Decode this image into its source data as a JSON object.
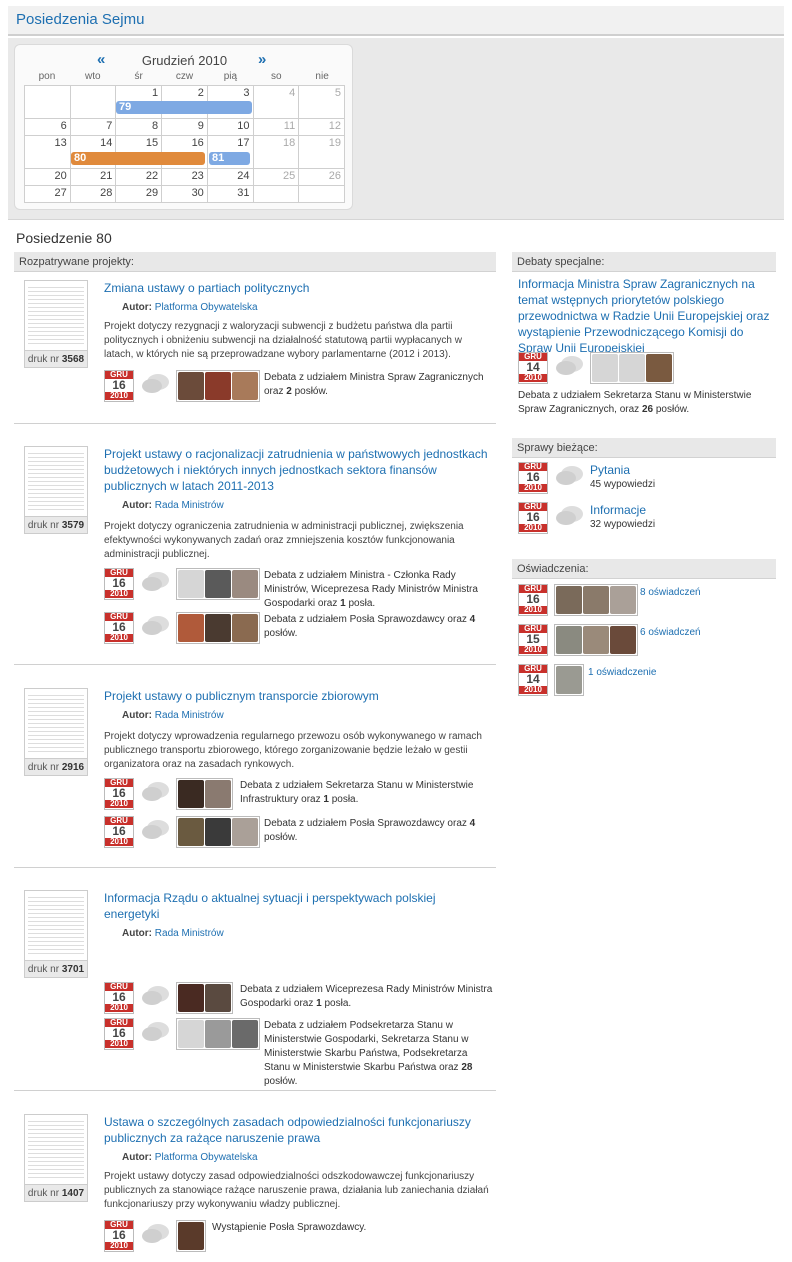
{
  "header": {
    "title": "Posiedzenia Sejmu"
  },
  "calendar": {
    "prev": "«",
    "next": "»",
    "month": "Grudzień 2010",
    "dow": [
      "pon",
      "wto",
      "śr",
      "czw",
      "pią",
      "so",
      "nie"
    ],
    "weeks": [
      [
        "",
        "",
        "1",
        "2",
        "3",
        "4",
        "5"
      ],
      [
        "6",
        "7",
        "8",
        "9",
        "10",
        "11",
        "12"
      ],
      [
        "13",
        "14",
        "15",
        "16",
        "17",
        "18",
        "19"
      ],
      [
        "20",
        "21",
        "22",
        "23",
        "24",
        "25",
        "26"
      ],
      [
        "27",
        "28",
        "29",
        "30",
        "31",
        "",
        ""
      ]
    ],
    "sittings": [
      {
        "label": "79",
        "color": "#7ea9e3"
      },
      {
        "label": "80",
        "color": "#e08a3c"
      },
      {
        "label": "81",
        "color": "#7ea9e3"
      }
    ]
  },
  "sitting": {
    "title": "Posiedzenie 80"
  },
  "projects_header": "Rozpatrywane projekty:",
  "author_label": "Autor:",
  "druk_label": "druk nr",
  "date": {
    "month": "GRU",
    "year": "2010"
  },
  "projects": [
    {
      "title": "Zmiana ustawy o partiach politycznych",
      "author": "Platforma Obywatelska",
      "druk": "3568",
      "desc": "Projekt dotyczy rezygnacji z waloryzacji subwencji z budżetu państwa dla partii politycznych i obniżeniu subwencji na działalność statutową partii wypłacanych w latach, w których nie są przeprowadzane wybory parlamentarne (2012 i 2013).",
      "debates": [
        {
          "day": "16",
          "text_a": "Debata z udziałem Ministra Spraw Zagranicznych oraz ",
          "count": "2",
          "text_b": " posłów."
        }
      ]
    },
    {
      "title": "Projekt ustawy o racjonalizacji zatrudnienia w państwowych jednostkach budżetowych i niektórych innych jednostkach sektora finansów publicznych w latach 2011-2013",
      "author": "Rada Ministrów",
      "druk": "3579",
      "desc": "Projekt dotyczy ograniczenia zatrudnienia w administracji publicznej, zwiększenia efektywności wykonywanych zadań oraz zmniejszenia kosztów funkcjonowania administracji publicznej.",
      "debates": [
        {
          "day": "16",
          "text_a": "Debata z udziałem Ministra - Członka Rady Ministrów, Wiceprezesa Rady Ministrów Ministra Gospodarki oraz ",
          "count": "1",
          "text_b": " posła."
        },
        {
          "day": "16",
          "text_a": "Debata z udziałem Posła Sprawozdawcy oraz ",
          "count": "4",
          "text_b": " posłów."
        }
      ]
    },
    {
      "title": "Projekt ustawy o publicznym transporcie zbiorowym",
      "author": "Rada Ministrów",
      "druk": "2916",
      "desc": "Projekt dotyczy wprowadzenia regularnego przewozu osób wykonywanego w ramach publicznego transportu zbiorowego, którego zorganizowanie będzie leżało w gestii organizatora oraz na zasadach rynkowych.",
      "debates": [
        {
          "day": "16",
          "text_a": "Debata z udziałem Sekretarza Stanu w Ministerstwie Infrastruktury oraz ",
          "count": "1",
          "text_b": " posła."
        },
        {
          "day": "16",
          "text_a": "Debata z udziałem Posła Sprawozdawcy oraz ",
          "count": "4",
          "text_b": " posłów."
        }
      ]
    },
    {
      "title": "Informacja Rządu o aktualnej sytuacji i perspektywach polskiej energetyki",
      "author": "Rada Ministrów",
      "druk": "3701",
      "desc": "",
      "debates": [
        {
          "day": "16",
          "text_a": "Debata z udziałem Wiceprezesa Rady Ministrów Ministra Gospodarki oraz ",
          "count": "1",
          "text_b": " posła."
        },
        {
          "day": "16",
          "text_a": "Debata z udziałem Podsekretarza Stanu w Ministerstwie Gospodarki, Sekretarza Stanu w Ministerstwie Skarbu Państwa, Podsekretarza Stanu w Ministerstwie Skarbu Państwa oraz ",
          "count": "28",
          "text_b": " posłów."
        }
      ]
    },
    {
      "title": "Ustawa o szczególnych zasadach odpowiedzialności funkcjonariuszy publicznych za rażące naruszenie prawa",
      "author": "Platforma Obywatelska",
      "druk": "1407",
      "desc": "Projekt ustawy dotyczy zasad odpowiedzialności odszkodowawczej funkcjonariuszy publicznych za stanowiące rażące naruszenie prawa, działania lub zaniechania działań funkcjonariuszy przy wykonywaniu władzy publicznej.",
      "debates": [
        {
          "day": "16",
          "text_a": "Wystąpienie Posła Sprawozdawcy.",
          "count": "",
          "text_b": ""
        }
      ]
    }
  ],
  "special": {
    "header": "Debaty specjalne:",
    "title": "Informacja Ministra Spraw Zagranicznych na temat wstępnych priorytetów polskiego przewodnictwa w Radzie Unii Europejskiej oraz wystąpienie Przewodniczącego Komisji do Spraw Unii Europejskiej",
    "day": "14",
    "text_a": "Debata z udziałem Sekretarza Stanu w Ministerstwie Spraw Zagranicznych, oraz ",
    "count": "26",
    "text_b": " posłów."
  },
  "current": {
    "header": "Sprawy bieżące:",
    "items": [
      {
        "day": "16",
        "title": "Pytania",
        "sub": "45 wypowiedzi"
      },
      {
        "day": "16",
        "title": "Informacje",
        "sub": "32 wypowiedzi"
      }
    ]
  },
  "statements": {
    "header": "Oświadczenia:",
    "items": [
      {
        "day": "16",
        "label": "8 oświadczeń"
      },
      {
        "day": "15",
        "label": "6 oświadczeń"
      },
      {
        "day": "14",
        "label": "1 oświadczenie"
      }
    ]
  },
  "colors": {
    "link": "#1d6fb1",
    "date_red": "#c8302b",
    "blue_bar": "#7ea9e3",
    "orange_bar": "#e08a3c"
  }
}
